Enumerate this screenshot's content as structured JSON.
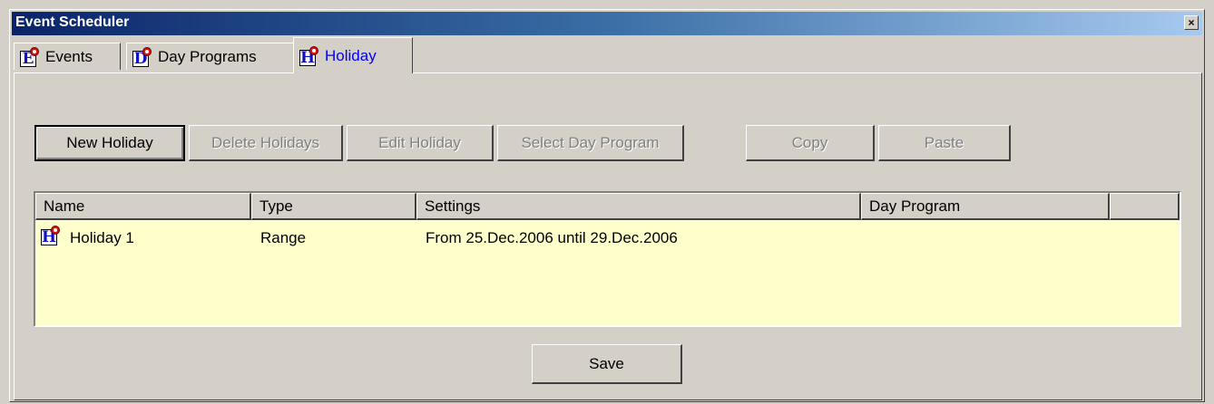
{
  "window": {
    "title": "Event Scheduler",
    "close_glyph": "×"
  },
  "tabs": [
    {
      "label": "Events",
      "icon_letter": "E",
      "icon": "events-icon"
    },
    {
      "label": "Day Programs",
      "icon_letter": "D",
      "icon": "day-programs-icon"
    },
    {
      "label": "Holiday",
      "icon_letter": "H",
      "icon": "holiday-icon",
      "active": true
    }
  ],
  "toolbar": {
    "new_holiday": "New Holiday",
    "delete_holidays": "Delete Holidays",
    "edit_holiday": "Edit Holiday",
    "select_day_program": "Select Day Program",
    "copy": "Copy",
    "paste": "Paste"
  },
  "table": {
    "columns": [
      "Name",
      "Type",
      "Settings",
      "Day Program"
    ],
    "rows": [
      {
        "icon_letter": "H",
        "name": "Holiday 1",
        "type": "Range",
        "settings": "From 25.Dec.2006 until 29.Dec.2006",
        "day_program": ""
      }
    ]
  },
  "footer": {
    "save": "Save"
  },
  "colors": {
    "grid_background": "#ffffcc",
    "active_tab_text": "#0000ff",
    "title_gradient_start": "#0a246a"
  }
}
